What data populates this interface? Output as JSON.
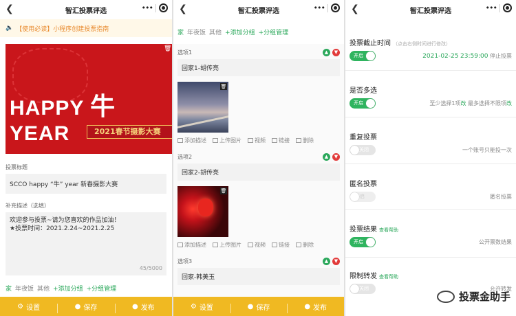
{
  "nav": {
    "title": "智汇投票评选",
    "back": "❮",
    "dots": "•••"
  },
  "panel1": {
    "notice": "【使用必读】小程序创建投票指南",
    "banner": {
      "title_a": "HAPPY ",
      "title_b": "牛",
      "title_c": "YEAR",
      "subtitle": "2021春节摄影大赛"
    },
    "title_label": "投票标题",
    "title_value": "SCCO happy “牛” year 新春摄影大赛",
    "desc_label": "补充描述（选填）",
    "desc_line1": "欢迎参与投票~请为您喜欢的作品加油！",
    "desc_line2": "★投票时间：2021.2.24~2021.2.25",
    "desc_counter": "45/5000",
    "groups": {
      "home": "家",
      "year": "年夜饭",
      "other": "其他",
      "add": "+添加分组",
      "manage": "+分组管理"
    }
  },
  "bottom_bar": {
    "settings": "设置",
    "save": "保存",
    "publish": "发布"
  },
  "panel2": {
    "groups": {
      "home": "家",
      "year": "年夜饭",
      "other": "其他",
      "add": "+添加分组",
      "manage": "+分组管理"
    },
    "options": [
      {
        "label": "选项1",
        "name": "回家1-胡传亮"
      },
      {
        "label": "选项2",
        "name": "回家2-胡传亮"
      },
      {
        "label": "选项3",
        "name": "回家-韩美玉"
      }
    ],
    "actions": {
      "desc": "添加描述",
      "image": "上传图片",
      "video": "视频",
      "link": "链接",
      "delete": "删除"
    }
  },
  "panel3": {
    "deadline": {
      "title": "投票截止时间",
      "hint": "（点击右侧时间进行修改）",
      "toggle": "开启",
      "date": "2021-02-25",
      "time": "23:59:00",
      "suffix": "停止投票"
    },
    "multi": {
      "title": "是否多选",
      "toggle": "开启",
      "d1": "至少选择1项",
      "d1l": "改",
      "d2": "最多选择不限项",
      "d2l": "改"
    },
    "repeat": {
      "title": "重复投票",
      "toggle": "关闭",
      "desc": "一个账号只能投一次"
    },
    "anon": {
      "title": "匿名投票",
      "toggle": "开启",
      "desc": "匿名投票"
    },
    "result": {
      "title": "投票结果",
      "help": "查看帮助",
      "toggle": "开启",
      "desc": "公开票数结果"
    },
    "forward": {
      "title": "限制转发",
      "help": "查看帮助",
      "toggle": "关闭",
      "desc": "允许转发"
    }
  },
  "watermark": "投票金助手",
  "colors": {
    "brand_green": "#2ba85b",
    "bar_yellow": "#f0b922",
    "banner_red": "#c9161b",
    "notice_orange": "#e8892c"
  }
}
